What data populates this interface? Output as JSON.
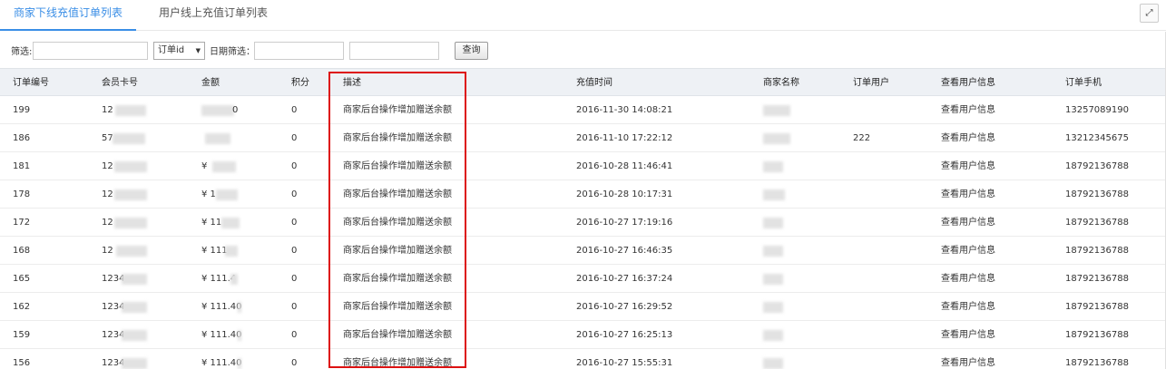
{
  "tabs": [
    {
      "label": "商家下线充值订单列表",
      "active": true
    },
    {
      "label": "用户线上充值订单列表",
      "active": false
    }
  ],
  "expand_icon": "expand-icon",
  "filter": {
    "label": "筛选:",
    "input_value": "",
    "select_value": "订单id",
    "date_label": "日期筛选：",
    "date_start": "",
    "date_end": "",
    "query_button": "查询"
  },
  "table": {
    "headers": [
      "订单编号",
      "会员卡号",
      "金额",
      "积分",
      "描述",
      "充值时间",
      "商家名称",
      "订单用户",
      "查看用户信息",
      "订单手机"
    ],
    "rows": [
      {
        "id": "199",
        "card": "12",
        "amount": "",
        "amount_tail": "0",
        "points": "0",
        "desc": "商家后台操作增加赠送余额",
        "time": "2016-11-30 14:08:21",
        "user": "",
        "view": "查看用户信息",
        "phone": "13257089190"
      },
      {
        "id": "186",
        "card": "57",
        "amount": "",
        "amount_tail": "",
        "points": "0",
        "desc": "商家后台操作增加赠送余额",
        "time": "2016-11-10 17:22:12",
        "user": "222",
        "view": "查看用户信息",
        "phone": "13212345675"
      },
      {
        "id": "181",
        "card": "12",
        "amount": "¥",
        "amount_tail": "",
        "points": "0",
        "desc": "商家后台操作增加赠送余额",
        "time": "2016-10-28 11:46:41",
        "user": "",
        "view": "查看用户信息",
        "phone": "18792136788"
      },
      {
        "id": "178",
        "card": "12",
        "amount": "¥ 1",
        "amount_tail": "",
        "points": "0",
        "desc": "商家后台操作增加赠送余额",
        "time": "2016-10-28 10:17:31",
        "user": "",
        "view": "查看用户信息",
        "phone": "18792136788"
      },
      {
        "id": "172",
        "card": "12",
        "amount": "¥ 11",
        "amount_tail": "",
        "points": "0",
        "desc": "商家后台操作增加赠送余额",
        "time": "2016-10-27 17:19:16",
        "user": "",
        "view": "查看用户信息",
        "phone": "18792136788"
      },
      {
        "id": "168",
        "card": "12",
        "amount": "¥ 111.",
        "amount_tail": "",
        "points": "0",
        "desc": "商家后台操作增加赠送余额",
        "time": "2016-10-27 16:46:35",
        "user": "",
        "view": "查看用户信息",
        "phone": "18792136788"
      },
      {
        "id": "165",
        "card": "1234",
        "amount": "¥ 111.4",
        "amount_tail": "",
        "points": "0",
        "desc": "商家后台操作增加赠送余额",
        "time": "2016-10-27 16:37:24",
        "user": "",
        "view": "查看用户信息",
        "phone": "18792136788"
      },
      {
        "id": "162",
        "card": "1234",
        "amount": "¥ 111.40",
        "amount_tail": "",
        "points": "0",
        "desc": "商家后台操作增加赠送余额",
        "time": "2016-10-27 16:29:52",
        "user": "",
        "view": "查看用户信息",
        "phone": "18792136788"
      },
      {
        "id": "159",
        "card": "1234",
        "amount": "¥ 111.40",
        "amount_tail": "",
        "points": "0",
        "desc": "商家后台操作增加赠送余额",
        "time": "2016-10-27 16:25:13",
        "user": "",
        "view": "查看用户信息",
        "phone": "18792136788"
      },
      {
        "id": "156",
        "card": "1234",
        "amount": "¥ 111.40",
        "amount_tail": "",
        "points": "0",
        "desc": "商家后台操作增加赠送余额",
        "time": "2016-10-27 15:55:31",
        "user": "",
        "view": "查看用户信息",
        "phone": "18792136788"
      }
    ]
  },
  "colors": {
    "accent": "#3a8ee6",
    "highlight": "#dd1111",
    "header_bg": "#eef1f5"
  }
}
